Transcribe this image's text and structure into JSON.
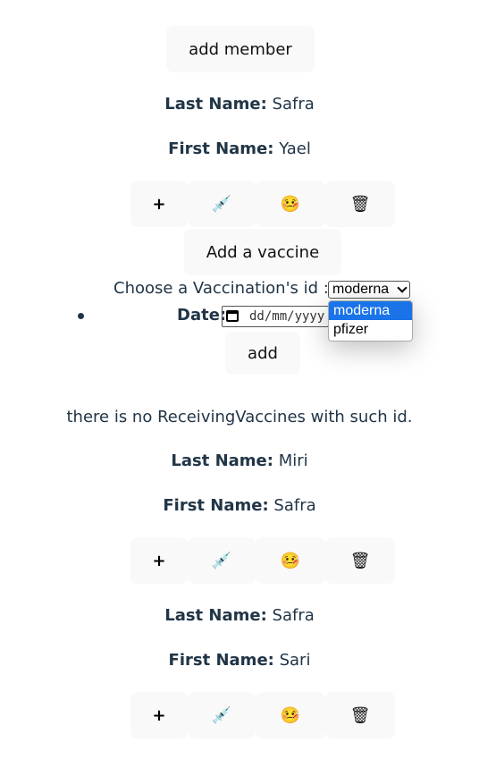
{
  "add_member_label": "add member",
  "members": [
    {
      "last_label": "Last Name:",
      "last": "Safra",
      "first_label": "First Name:",
      "first": "Yael"
    },
    {
      "last_label": "Last Name:",
      "last": "Miri",
      "first_label": "First Name:",
      "first": "Safra"
    },
    {
      "last_label": "Last Name:",
      "last": "Safra",
      "first_label": "First Name:",
      "first": "Sari"
    }
  ],
  "actions": {
    "plus": "+",
    "syringe_emoji": "💉",
    "sick_emoji": "🤒",
    "trash_emoji": "🗑"
  },
  "vaccine_form": {
    "title": "Add a vaccine",
    "choose_label": "Choose a Vaccination's id :",
    "selected": "moderna",
    "options": [
      "moderna",
      "pfizer"
    ],
    "date_label": "Date:",
    "date_placeholder": "dd/mm/yyyy",
    "add_label": "add"
  },
  "message": "there is no ReceivingVaccines with such id.",
  "colors": {
    "text": "#213547",
    "button_bg": "#f9f9f9",
    "selected_option": "#1a73e8"
  }
}
